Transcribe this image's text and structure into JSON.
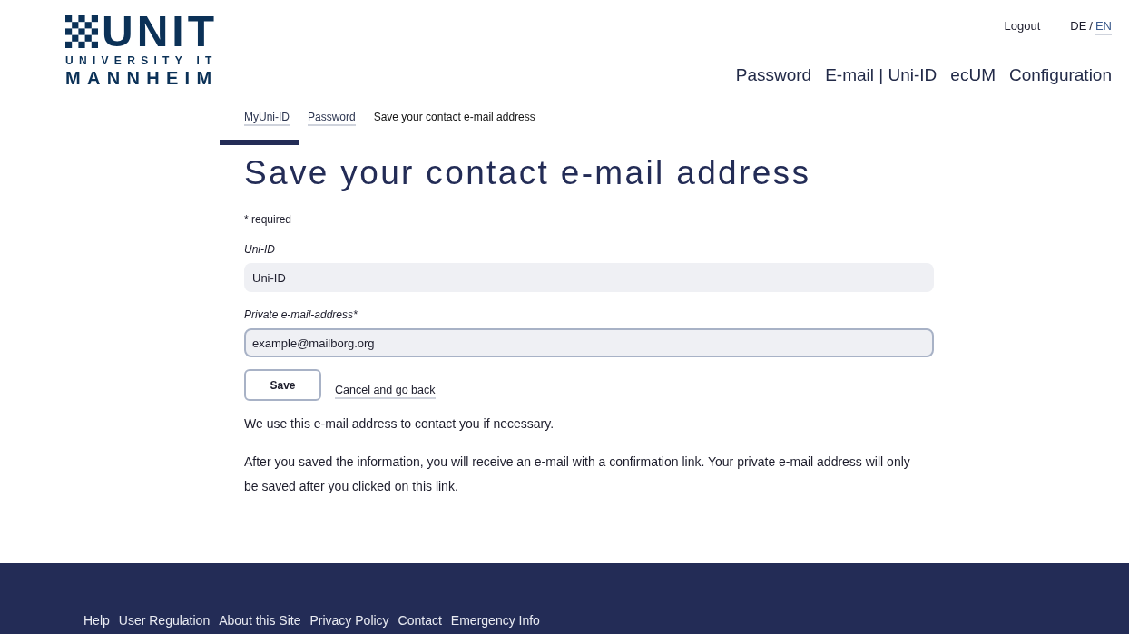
{
  "header": {
    "logo": {
      "title": "UNIT",
      "subtitle": "UNIVERSITY IT",
      "place": "MANNHEIM"
    },
    "utility_links": [
      {
        "label": "Logout"
      }
    ],
    "languages": [
      {
        "label": "DE",
        "selected": false
      },
      {
        "label": "EN",
        "selected": true
      }
    ],
    "language_separator": "/",
    "nav": [
      {
        "label": "Password"
      },
      {
        "label": "E-mail | Uni-ID"
      },
      {
        "label": "ecUM"
      },
      {
        "label": "Configuration"
      }
    ]
  },
  "breadcrumb": [
    {
      "label": "MyUni-ID",
      "current": false
    },
    {
      "label": "Password",
      "current": false
    },
    {
      "label": "Save your contact e-mail address",
      "current": true
    }
  ],
  "page_title": "Save your contact e-mail address",
  "form": {
    "required_note": "* required",
    "fields": [
      {
        "label": "Uni-ID",
        "value": "Uni-ID",
        "focused": false
      },
      {
        "label": "Private e-mail-address*",
        "value": "example@mailborg.org",
        "focused": true
      }
    ],
    "actions": [
      {
        "label": "Save",
        "kind": "button"
      },
      {
        "label": "Cancel and go back",
        "kind": "link"
      }
    ]
  },
  "notes": [
    "We use this e-mail address to contact you if necessary.",
    "After you saved the information, you will receive an e-mail with a confirmation link. Your private e-mail address will only be saved after you clicked on this link."
  ],
  "footer": {
    "links": [
      {
        "label": "Help"
      },
      {
        "label": "User Regulation"
      },
      {
        "label": "About this Site"
      },
      {
        "label": "Privacy Policy"
      },
      {
        "label": "Contact"
      },
      {
        "label": "Emergency Info"
      }
    ]
  }
}
